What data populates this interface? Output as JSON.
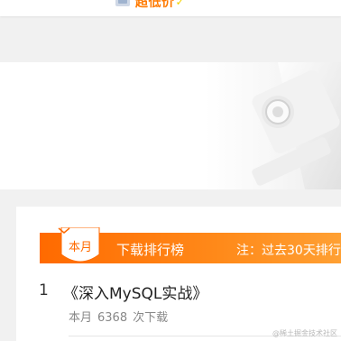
{
  "promo": {
    "text": "超低价",
    "icon": "price-tag-icon",
    "accent": "#ff7a00"
  },
  "banner": {
    "decoration": "lens-decoration"
  },
  "ranking": {
    "badge": "本月",
    "title": "下载排行榜",
    "note": "注：过去30天排行",
    "header_color": "#ff6a00",
    "items": [
      {
        "rank": "1",
        "title": "《深入MySQL实战》",
        "period": "本月",
        "count": "6368",
        "suffix": "次下载"
      }
    ]
  },
  "watermark": "@稀土掘金技术社区"
}
